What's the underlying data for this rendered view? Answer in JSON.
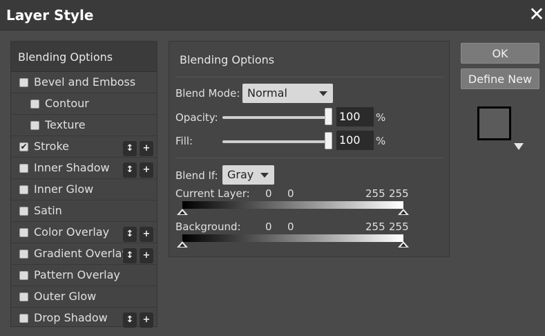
{
  "dialog": {
    "title": "Layer Style",
    "close_glyph": "✕"
  },
  "sidebar": {
    "header": "Blending Options",
    "items": [
      {
        "label": "Bevel and Emboss",
        "checked": false,
        "indent": 0,
        "buttons": false
      },
      {
        "label": "Contour",
        "checked": false,
        "indent": 1,
        "buttons": false
      },
      {
        "label": "Texture",
        "checked": false,
        "indent": 1,
        "buttons": false
      },
      {
        "label": "Stroke",
        "checked": true,
        "indent": 0,
        "buttons": true
      },
      {
        "label": "Inner Shadow",
        "checked": false,
        "indent": 0,
        "buttons": true
      },
      {
        "label": "Inner Glow",
        "checked": false,
        "indent": 0,
        "buttons": false
      },
      {
        "label": "Satin",
        "checked": false,
        "indent": 0,
        "buttons": false
      },
      {
        "label": "Color Overlay",
        "checked": false,
        "indent": 0,
        "buttons": true
      },
      {
        "label": "Gradient Overlay",
        "checked": false,
        "indent": 0,
        "buttons": true
      },
      {
        "label": "Pattern Overlay",
        "checked": false,
        "indent": 0,
        "buttons": false
      },
      {
        "label": "Outer Glow",
        "checked": false,
        "indent": 0,
        "buttons": false
      },
      {
        "label": "Drop Shadow",
        "checked": false,
        "indent": 0,
        "buttons": true
      }
    ],
    "reorder_glyph": "↕",
    "add_glyph": "+",
    "check_glyph": "✔"
  },
  "panel": {
    "title": "Blending Options",
    "blend_mode": {
      "label": "Blend Mode:",
      "value": "Normal"
    },
    "opacity": {
      "label": "Opacity:",
      "value": "100",
      "unit": "%",
      "fraction": 1.0
    },
    "fill": {
      "label": "Fill:",
      "value": "100",
      "unit": "%",
      "fraction": 1.0
    },
    "blend_if": {
      "label": "Blend If:",
      "value": "Gray"
    },
    "current_layer": {
      "label": "Current Layer:",
      "low_a": "0",
      "low_b": "0",
      "high_a": "255",
      "high_b": "255"
    },
    "background": {
      "label": "Background:",
      "low_a": "0",
      "low_b": "0",
      "high_a": "255",
      "high_b": "255"
    }
  },
  "buttons": {
    "ok": "OK",
    "define_new": "Define New"
  },
  "colors": {
    "bg": "#4a4a4a",
    "titlebar": "#3a3a3a",
    "button": "#7a7a7a",
    "preview_fill": "#5b5b5b"
  }
}
